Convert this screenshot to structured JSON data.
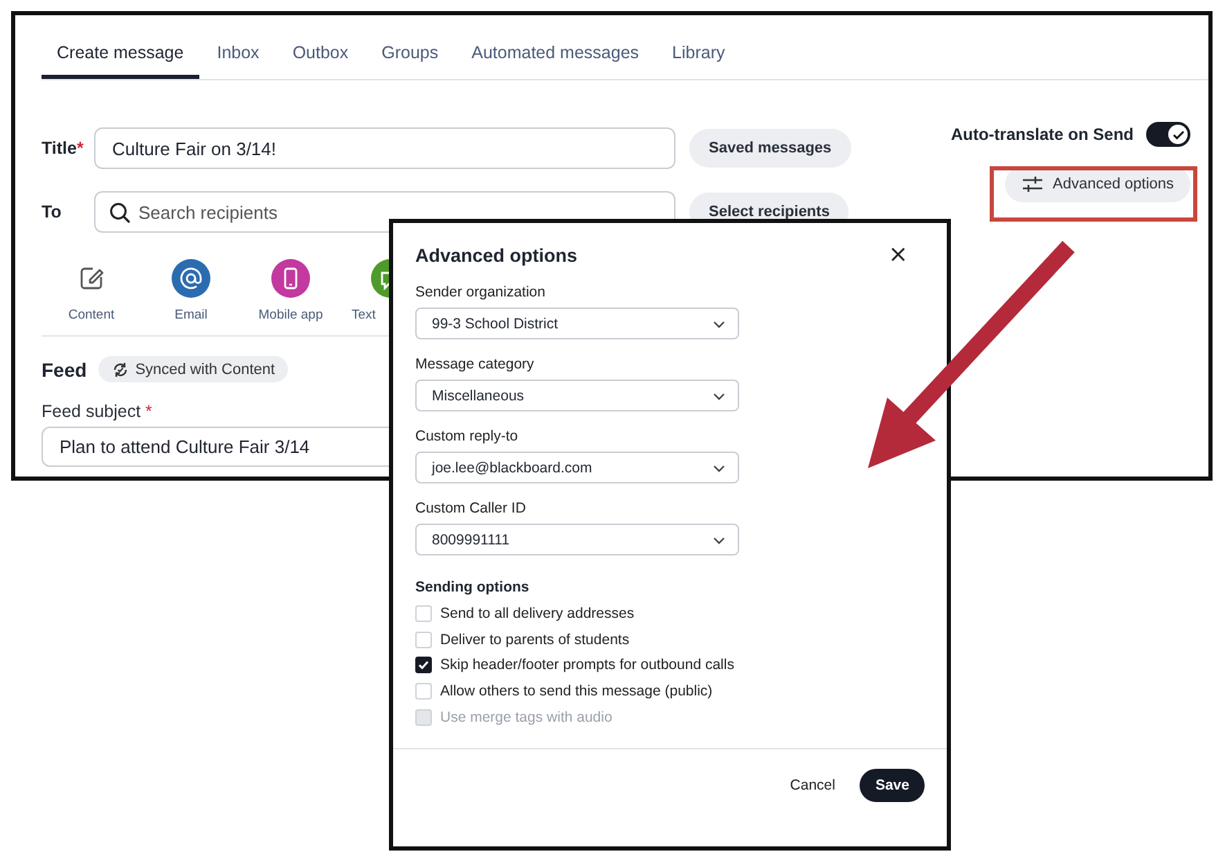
{
  "tabs": [
    {
      "label": "Create message",
      "selected": true
    },
    {
      "label": "Inbox",
      "selected": false
    },
    {
      "label": "Outbox",
      "selected": false
    },
    {
      "label": "Groups",
      "selected": false
    },
    {
      "label": "Automated messages",
      "selected": false
    },
    {
      "label": "Library",
      "selected": false
    }
  ],
  "form": {
    "title": {
      "label": "Title",
      "required_mark": "*",
      "value": "Culture Fair on 3/14!"
    },
    "saved_messages_button": "Saved messages",
    "to": {
      "label": "To",
      "placeholder": "Search recipients"
    },
    "select_recipients_button": "Select recipients",
    "channels": [
      {
        "label": "Content",
        "kind": "outline"
      },
      {
        "label": "Email",
        "kind": "email",
        "color": "#2b6cb0"
      },
      {
        "label": "Mobile app",
        "kind": "phone",
        "color": "#c2399f"
      },
      {
        "label": "Text",
        "kind": "chat",
        "color": "#4f9a2a"
      }
    ],
    "feed": {
      "heading": "Feed",
      "sync_badge": "Synced with Content",
      "subject_label": "Feed subject",
      "subject_required_mark": "*",
      "subject_value": "Plan to attend Culture Fair 3/14"
    }
  },
  "auto_translate": {
    "label": "Auto-translate on Send",
    "on": true
  },
  "advanced_options_button": "Advanced options",
  "dialog": {
    "title": "Advanced options",
    "close": "×",
    "selects": [
      {
        "label": "Sender organization",
        "value": "99-3 School District"
      },
      {
        "label": "Message category",
        "value": "Miscellaneous"
      },
      {
        "label": "Custom reply-to",
        "value": "joe.lee@blackboard.com"
      },
      {
        "label": "Custom Caller ID",
        "value": "8009991111"
      }
    ],
    "sending_options_heading": "Sending options",
    "options": [
      {
        "label": "Send to all delivery addresses",
        "checked": false,
        "disabled": false
      },
      {
        "label": "Deliver to parents of students",
        "checked": false,
        "disabled": false
      },
      {
        "label": "Skip header/footer prompts for outbound calls",
        "checked": true,
        "disabled": false
      },
      {
        "label": "Allow others to send this message (public)",
        "checked": false,
        "disabled": false
      },
      {
        "label": "Use merge tags with audio",
        "checked": false,
        "disabled": true
      }
    ],
    "cancel_button": "Cancel",
    "save_button": "Save"
  }
}
